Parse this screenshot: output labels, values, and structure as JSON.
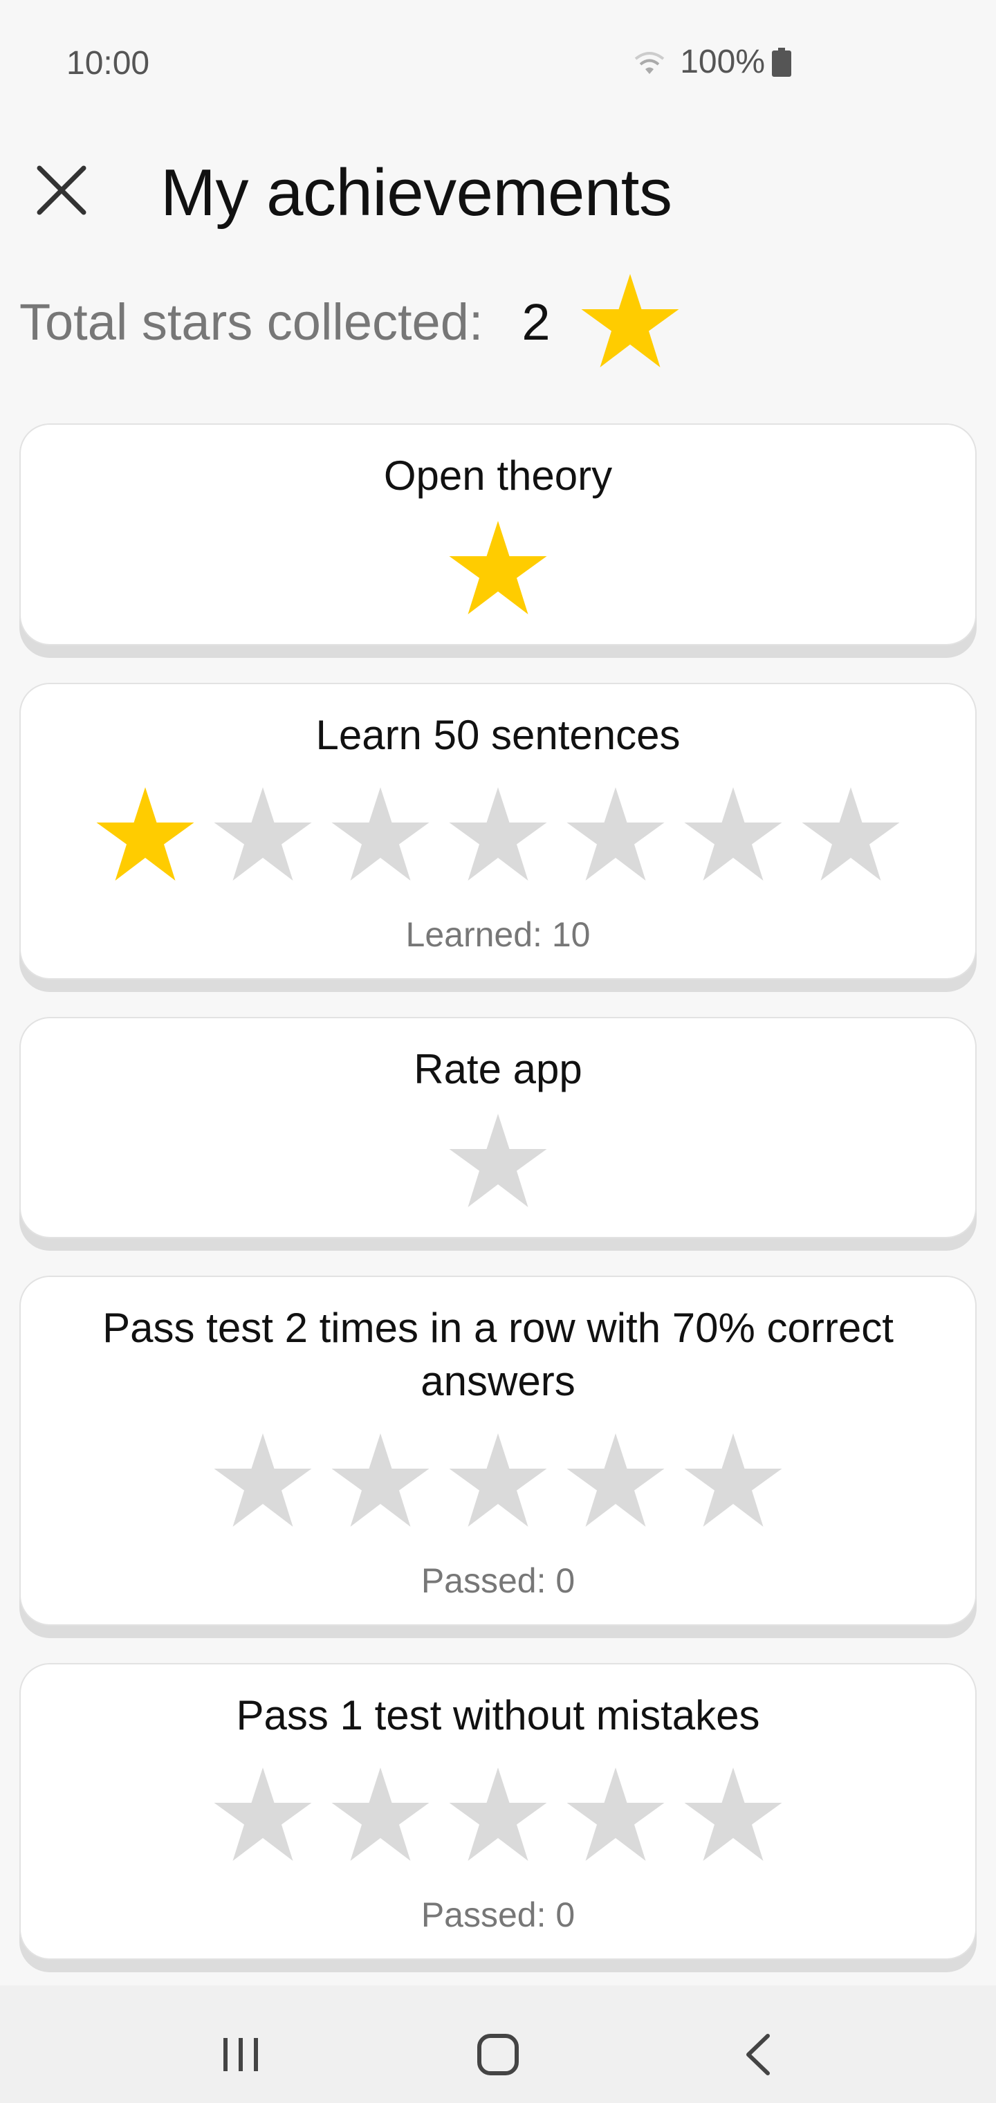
{
  "status_bar": {
    "time": "10:00",
    "battery": "100%"
  },
  "header": {
    "title": "My achievements",
    "close_icon": "close-icon"
  },
  "total": {
    "label": "Total stars collected:",
    "value": "2"
  },
  "colors": {
    "star_filled": "#FFCC00",
    "star_empty": "#DADADA",
    "background": "#F7F7F7"
  },
  "cards": [
    {
      "title": "Open theory",
      "stars": [
        true
      ],
      "subtitle": ""
    },
    {
      "title": "Learn 50 sentences",
      "stars": [
        true,
        false,
        false,
        false,
        false,
        false,
        false
      ],
      "subtitle": "Learned: 10"
    },
    {
      "title": "Rate app",
      "stars": [
        false
      ],
      "subtitle": ""
    },
    {
      "title": "Pass test 2 times in a row with 70% correct answers",
      "stars": [
        false,
        false,
        false,
        false,
        false
      ],
      "subtitle": "Passed: 0"
    },
    {
      "title": "Pass 1 test without mistakes",
      "stars": [
        false,
        false,
        false,
        false,
        false
      ],
      "subtitle": "Passed: 0"
    }
  ],
  "nav_bar": {
    "recent_icon": "recent-apps-icon",
    "home_icon": "home-icon",
    "back_icon": "back-icon"
  }
}
